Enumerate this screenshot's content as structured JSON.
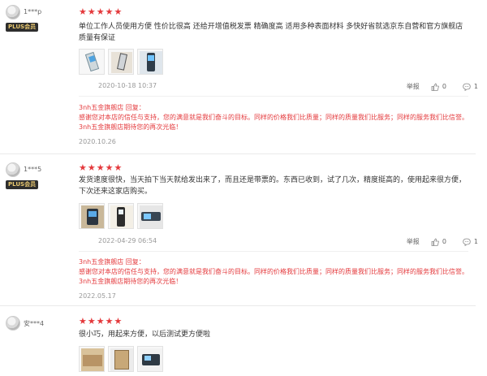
{
  "reviews": [
    {
      "username": "1***p",
      "badge": "PLUS会员",
      "stars": 5,
      "content": "单位工作人员使用方便 性价比很高 还给开增值税发票 精确度高 适用多种表面材料 多快好省就选京东自营和官方旗舰店 质量有保证",
      "date": "2020-10-18 10:37",
      "report_label": "举报",
      "likes": "0",
      "replies": "1",
      "reply": {
        "store": "3nh五金旗舰店",
        "reply_label": "回复：",
        "text": "感谢您对本店的信任与支持，您的满意就是我们奋斗的目标。同样的价格我们比质量；同样的质量我们比服务；同样的服务我们比信誉。3nh五金旗舰店期待您的再次光临！",
        "date": "2020.10.26"
      }
    },
    {
      "username": "1***5",
      "badge": "PLUS会员",
      "stars": 5,
      "content": "发货速度很快，当天拍下当天就给发出来了，而且还是带票的。东西已收到，试了几次，精度挺高的，使用起来很方便，下次还来这家店购买。",
      "date": "2022-04-29 06:54",
      "report_label": "举报",
      "likes": "0",
      "replies": "1",
      "reply": {
        "store": "3nh五金旗舰店",
        "reply_label": "回复：",
        "text": "感谢您对本店的信任与支持，您的满意就是我们奋斗的目标。同样的价格我们比质量；同样的质量我们比服务；同样的服务我们比信誉。3nh五金旗舰店期待您的再次光临！",
        "date": "2022.05.17"
      }
    },
    {
      "username": "安***4",
      "stars": 5,
      "content": "很小巧，用起来方便，以后测试更方便啦"
    }
  ],
  "colors": {
    "accent": "#e4393c",
    "muted": "#999999",
    "badge_bg": "#2e2e2e",
    "badge_fg": "#e8c870"
  }
}
